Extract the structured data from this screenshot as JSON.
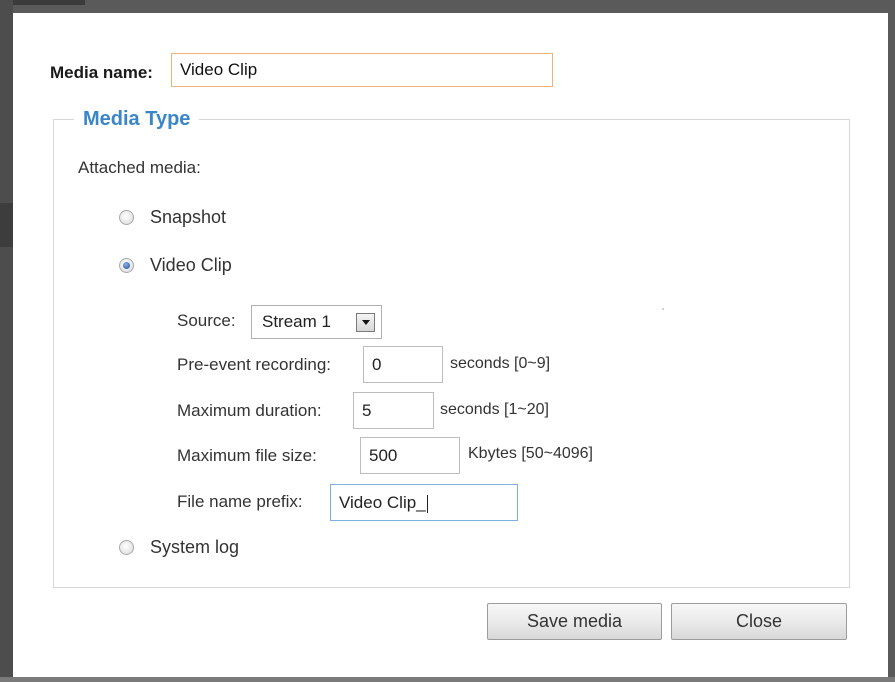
{
  "dialog": {
    "media_name": {
      "label": "Media name:",
      "value": "Video Clip"
    },
    "media_type": {
      "legend": "Media Type",
      "attached_label": "Attached media:",
      "options": [
        {
          "label": "Snapshot",
          "checked": false
        },
        {
          "label": "Video Clip",
          "checked": true
        },
        {
          "label": "System log",
          "checked": false
        }
      ]
    },
    "video_clip": {
      "source": {
        "label": "Source:",
        "value": "Stream 1"
      },
      "pre_event": {
        "label": "Pre-event recording:",
        "value": "0",
        "hint": "seconds [0~9]"
      },
      "max_duration": {
        "label": "Maximum duration:",
        "value": "5",
        "hint": "seconds [1~20]"
      },
      "max_file_size": {
        "label": "Maximum file size:",
        "value": "500",
        "hint": "Kbytes [50~4096]"
      },
      "file_prefix": {
        "label": "File name prefix:",
        "value": "Video Clip_"
      }
    },
    "buttons": {
      "save": "Save media",
      "close": "Close"
    },
    "colors": {
      "legend": "#3a86c8",
      "focus_border": "#7fb1e0",
      "name_border": "#f0b27a"
    }
  }
}
